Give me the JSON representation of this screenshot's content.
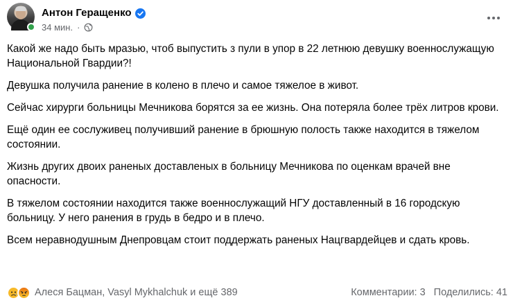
{
  "post": {
    "author": {
      "name": "Антон Геращенко",
      "verified": true,
      "online": true
    },
    "meta": {
      "timestamp": "34 мин.",
      "separator": "·",
      "audience_icon": "globe-icon"
    },
    "more_icon": "more-options-icon",
    "paragraphs": [
      "Какой же надо быть мразью, чтоб выпустить з пули в упор в 22 летнюю девушку военнослужащую Национальной Гвардии?!",
      "Девушка получила ранение в колено в плечо и самое тяжелое в живот.",
      "Сейчас хирурги больницы Мечникова борятся за ее жизнь. Она потеряла более трёх литров крови.",
      "Ещё один ее сослуживец получивший ранение в брюшную полость также находится в тяжелом состоянии.",
      "Жизнь других двоих раненых доставленых в больницу Мечникова по оценкам врачей вне опасности.",
      "В тяжелом состоянии находится также военнослужащий НГУ доставленный в 16 городскую больницу. У него ранения в грудь в бедро и в плечо.",
      "Всем неравнодушным Днепровцам стоит поддержать раненых Нацгвардейцев и сдать кровь."
    ],
    "reactions": {
      "icons": [
        "sad-reaction-icon",
        "angry-reaction-icon"
      ],
      "summary": "Алеся Бацман, Vasyl Mykhalchuk и ещё 389"
    },
    "counts": {
      "comments": "Комментарии: 3",
      "shares": "Поделились: 41"
    },
    "colors": {
      "text": "#050505",
      "secondary": "#65676b",
      "verified": "#1877f2",
      "online": "#31a24c"
    }
  }
}
